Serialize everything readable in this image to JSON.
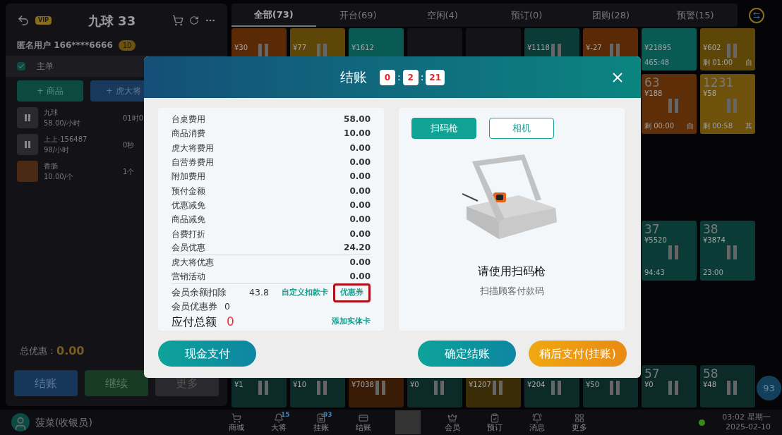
{
  "order_panel": {
    "vip_badge": "VIP",
    "title": "九球 33",
    "customer": "匿名用户 166****6666",
    "customer_badge": "10",
    "main_order": {
      "label": "主单",
      "checked": true
    },
    "add_buttons": [
      "+ 商品",
      "+ 虎大将"
    ],
    "items": [
      {
        "kind": "table",
        "name": "九球",
        "price": "58.00/小时",
        "amount": "01时0"
      },
      {
        "kind": "table",
        "name": "上上·156487",
        "price": "98/小时",
        "amount": "0秒"
      },
      {
        "kind": "food",
        "name": "香肠",
        "price": "10.00/个",
        "amount": "1个"
      }
    ],
    "discount_label": "总优惠：",
    "discount_value": "0.00",
    "actions": [
      {
        "label": "结账",
        "kind": "checkout"
      },
      {
        "label": "继续",
        "kind": "continue"
      },
      {
        "label": "更多",
        "kind": "more"
      }
    ]
  },
  "tabs": [
    {
      "label": "全部(73)",
      "selected": true
    },
    {
      "label": "开台(69)",
      "selected": false
    },
    {
      "label": "空闲(4)",
      "selected": false
    },
    {
      "label": "预订(0)",
      "selected": false
    },
    {
      "label": "团购(28)",
      "selected": false
    },
    {
      "label": "预警(15)",
      "selected": false
    }
  ],
  "tile_rows": [
    [
      {
        "kind": "paused",
        "price": "¥30",
        "color": "#5a2a06"
      },
      {
        "kind": "paused",
        "price": "¥77",
        "color": "#5e4608"
      },
      {
        "kind": "running",
        "price": "¥1612",
        "color": "#0a5a54"
      },
      {
        "kind": "idle",
        "color": "#141418"
      },
      {
        "kind": "idle",
        "color": "#141418"
      },
      {
        "kind": "paused",
        "price": "¥1118",
        "color": "#0b3b37"
      },
      {
        "kind": "paused",
        "price": "¥-27",
        "color": "#5a2a06"
      },
      {
        "kind": "running",
        "price": "¥21895",
        "time": "465:48",
        "color": "#0a5a54"
      },
      {
        "kind": "paused",
        "price": "¥602",
        "time": "剩 01:00",
        "tag": "自",
        "color": "#5e4608"
      }
    ],
    [
      {
        "kind": "empty"
      },
      {
        "kind": "empty"
      },
      {
        "kind": "empty"
      },
      {
        "kind": "empty"
      },
      {
        "kind": "empty"
      },
      {
        "kind": "empty"
      },
      {
        "kind": "empty"
      },
      {
        "kind": "paused",
        "number": "63",
        "price": "¥188",
        "time": "剩 00:00",
        "tag": "自",
        "color": "#5e2e08"
      },
      {
        "kind": "paused",
        "number": "1231",
        "price": "¥58",
        "time": "剩 00:58",
        "tag": "其",
        "color": "#6e520c"
      }
    ],
    [
      {
        "kind": "empty"
      },
      {
        "kind": "empty"
      },
      {
        "kind": "empty"
      },
      {
        "kind": "empty"
      },
      {
        "kind": "empty"
      },
      {
        "kind": "empty"
      },
      {
        "kind": "empty"
      },
      {
        "kind": "paused",
        "number": "37",
        "price": "¥5520",
        "time": "94:43",
        "color": "#0b3b37"
      },
      {
        "kind": "paused",
        "number": "38",
        "price": "¥3874",
        "time": "23:00",
        "color": "#0b3b37"
      }
    ],
    [
      {
        "kind": "paused",
        "price": "¥1",
        "color": "#0b2a28"
      },
      {
        "kind": "paused",
        "price": "¥10",
        "color": "#0b2a28"
      },
      {
        "kind": "paused",
        "price": "¥7038",
        "color": "#3a1c06"
      },
      {
        "kind": "paused",
        "price": "¥0",
        "color": "#0b2a28"
      },
      {
        "kind": "paused",
        "price": "¥1207",
        "color": "#3a2c06"
      },
      {
        "kind": "paused",
        "price": "¥204",
        "color": "#0b2a28"
      },
      {
        "kind": "paused",
        "price": "¥50",
        "color": "#0b2a28"
      },
      {
        "kind": "paused",
        "number": "57",
        "price": "¥0",
        "color": "#0b2a28"
      },
      {
        "kind": "paused",
        "number": "58",
        "price": "¥48",
        "color": "#0b2a28"
      }
    ]
  ],
  "floating_count": "93",
  "checkout_dialog": {
    "title": "结账",
    "timer": [
      "0",
      "2",
      "21"
    ],
    "timer_separator": ":",
    "fees": [
      {
        "label": "台桌费用",
        "value": "58.00"
      },
      {
        "label": "商品消费",
        "value": "10.00"
      },
      {
        "label": "虎大将费用",
        "value": "0.00"
      },
      {
        "label": "自营券费用",
        "value": "0.00"
      },
      {
        "label": "附加费用",
        "value": "0.00"
      },
      {
        "label": "预付金额",
        "value": "0.00"
      },
      {
        "label": "优惠减免",
        "value": "0.00"
      },
      {
        "label": "商品减免",
        "value": "0.00"
      },
      {
        "label": "台费打折",
        "value": "0.00"
      },
      {
        "label": "会员优惠",
        "value": "24.20",
        "divider_after": true
      },
      {
        "label": "虎大将优惠",
        "value": "0.00"
      },
      {
        "label": "营销活动",
        "value": "0.00",
        "divider_after": true
      }
    ],
    "balance_label": "会员余额扣除",
    "balance_value": "43.8",
    "custom_card_link": "自定义扣款卡",
    "coupon_link": {
      "label": "优惠券",
      "highlighted": true
    },
    "member_coupon_label": "会员优惠券",
    "member_coupon_value": "0",
    "total_label": "应付总额",
    "total_value": "0",
    "add_card_link": "添加实体卡",
    "scan_tabs": [
      {
        "label": "扫码枪",
        "selected": true
      },
      {
        "label": "相机",
        "selected": false
      }
    ],
    "scan_title": "请使用扫码枪",
    "scan_hint": "扫描顾客付款码",
    "buttons": [
      {
        "label": "现金支付",
        "kind": "primary"
      },
      {
        "label": "确定结账",
        "kind": "primary"
      },
      {
        "label": "稍后支付(挂账)",
        "kind": "warning"
      }
    ]
  },
  "bottom_bar": {
    "user": "菠菜(收银员)",
    "nav": [
      {
        "kind": "cart",
        "label": "商城"
      },
      {
        "kind": "bell",
        "label": "大将",
        "badge": "15"
      },
      {
        "kind": "doc",
        "label": "挂账",
        "badge": "93"
      },
      {
        "kind": "card",
        "label": "结账"
      },
      {
        "kind": "photo"
      },
      {
        "kind": "crown",
        "label": "会员"
      },
      {
        "kind": "clipboard",
        "label": "预订"
      },
      {
        "kind": "message",
        "label": "消息"
      },
      {
        "kind": "grid",
        "label": "更多"
      }
    ],
    "online": true,
    "time": "03:02",
    "weekday": "星期一",
    "date": "2025-02-10"
  }
}
